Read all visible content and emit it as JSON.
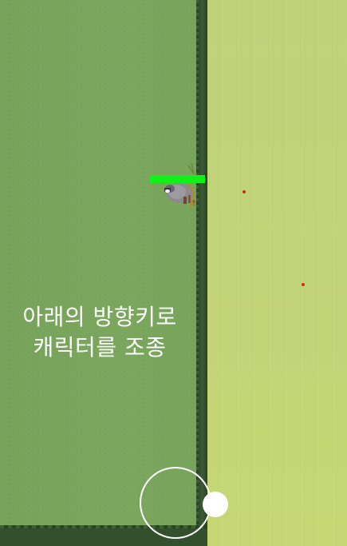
{
  "instruction": {
    "line1": "아래의 방향키로",
    "line2": "캐릭터를 조종"
  },
  "player": {
    "health_fraction": 1.0,
    "health_color": "#12f01a"
  },
  "enemies": [
    {
      "name": "enemy-dot-1",
      "color": "#d42a1a"
    },
    {
      "name": "enemy-dot-2",
      "color": "#d42a1a"
    }
  ],
  "colors": {
    "grass": "#7aa65e",
    "hedge": "#33502d",
    "field": "#c1d477"
  },
  "joystick": {
    "state": "idle-right"
  }
}
